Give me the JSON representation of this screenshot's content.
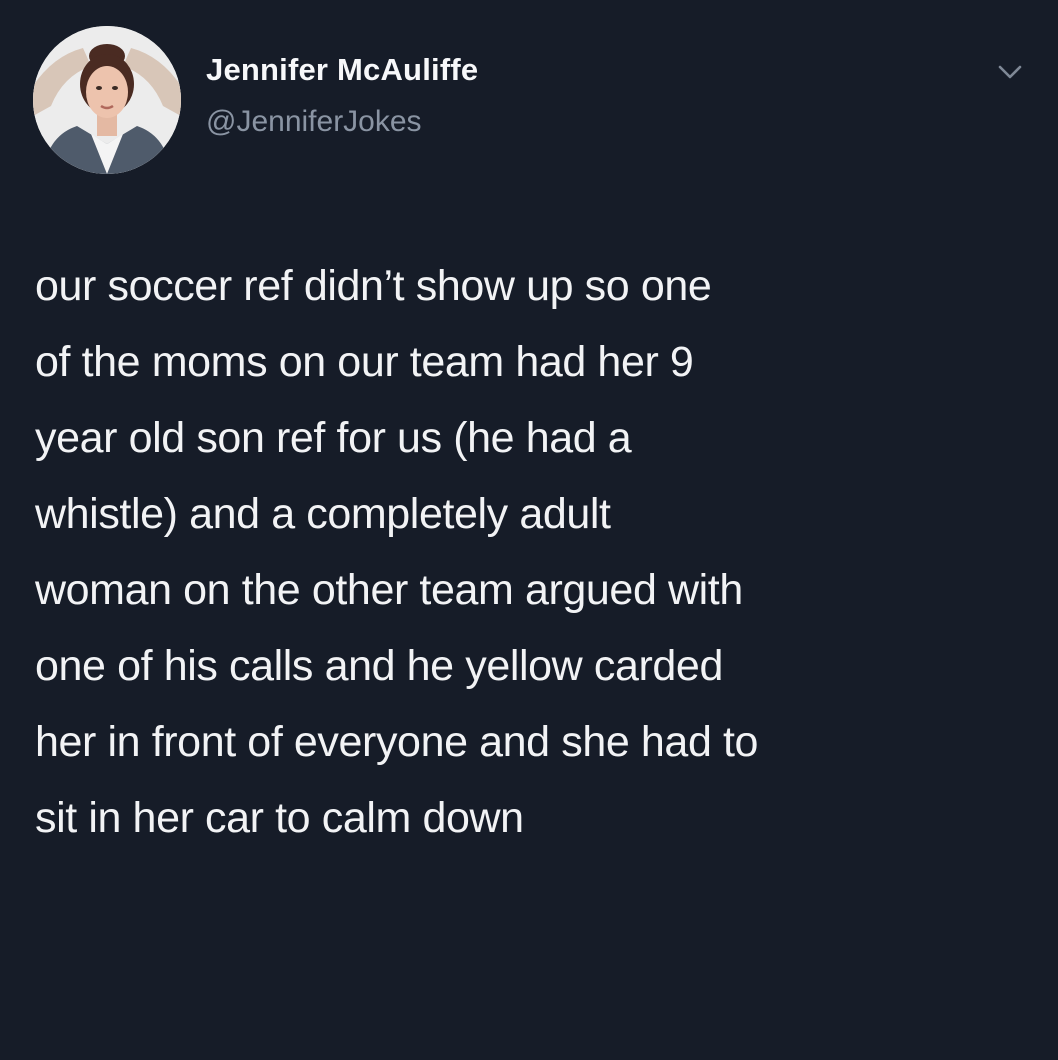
{
  "author": {
    "display_name": "Jennifer McAuliffe",
    "handle": "@JenniferJokes",
    "avatar_icon": "profile-photo"
  },
  "menu": {
    "icon": "chevron-down-icon"
  },
  "tweet": {
    "lines": [
      "our soccer ref didn’t show up so one",
      "of the moms on our team had her 9",
      "year old son ref for us (he had a",
      "whistle) and a completely adult",
      "woman on the other team argued with",
      "one of his calls and he yellow carded",
      "her in front of everyone and she had to",
      "sit in her car to calm down"
    ]
  },
  "colors": {
    "background": "#161c28",
    "text": "#f2f3f5",
    "secondary_text": "#8a94a3"
  }
}
